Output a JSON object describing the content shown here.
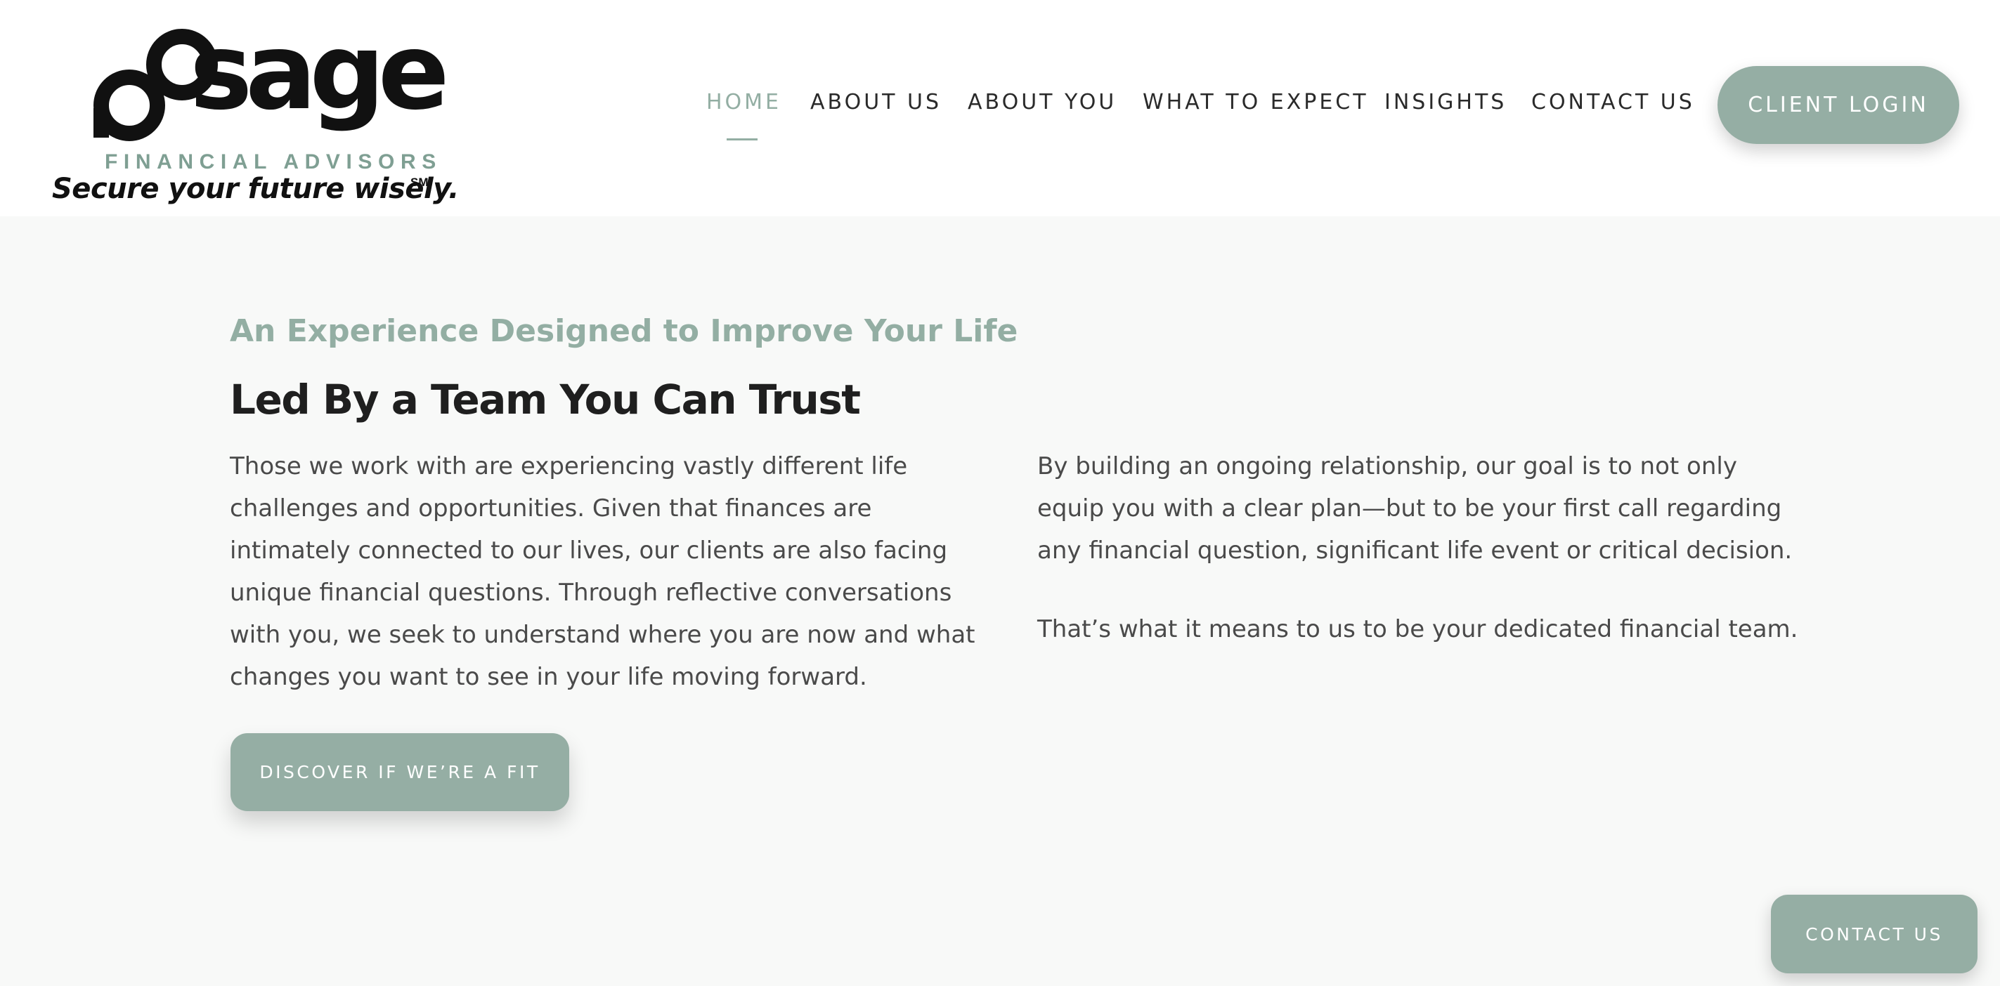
{
  "brand": {
    "name": "sage",
    "subtitle": "FINANCIAL ADVISORS",
    "tagline": "Secure your future wisely.",
    "tagline_mark": "SM"
  },
  "nav": {
    "items": [
      {
        "label": "HOME",
        "active": true
      },
      {
        "label": "ABOUT US",
        "active": false
      },
      {
        "label": "ABOUT YOU",
        "active": false
      },
      {
        "label": "WHAT TO EXPECT",
        "active": false
      },
      {
        "label": "INSIGHTS",
        "active": false
      },
      {
        "label": "CONTACT US",
        "active": false
      }
    ],
    "login_label": "CLIENT LOGIN"
  },
  "main": {
    "eyebrow": "An Experience Designed to Improve Your Life",
    "headline": "Led By a Team You Can Trust",
    "paragraph_left": "Those we work with are experiencing vastly different life challenges and opportunities. Given that finances are intimately connected to our lives, our clients are also facing unique financial questions. Through reflective conversations with you, we seek to understand where you are now and what changes you want to see in your life moving forward.",
    "paragraph_right_1": "By building an ongoing relationship, our goal is to not only equip you with a clear plan—but to be your first call regarding any financial question, significant life event or critical decision.",
    "paragraph_right_2": "That’s what it means to us to be your dedicated financial team.",
    "cta_label": "DISCOVER IF WE’RE A FIT"
  },
  "floating": {
    "contact_label": "CONTACT US"
  },
  "colors": {
    "accent": "#95aea4",
    "header_bg": "#ffffff",
    "page_bg": "#f8f9f8",
    "text_dark": "#1f1f1f",
    "text_body": "#4a4a4a"
  }
}
